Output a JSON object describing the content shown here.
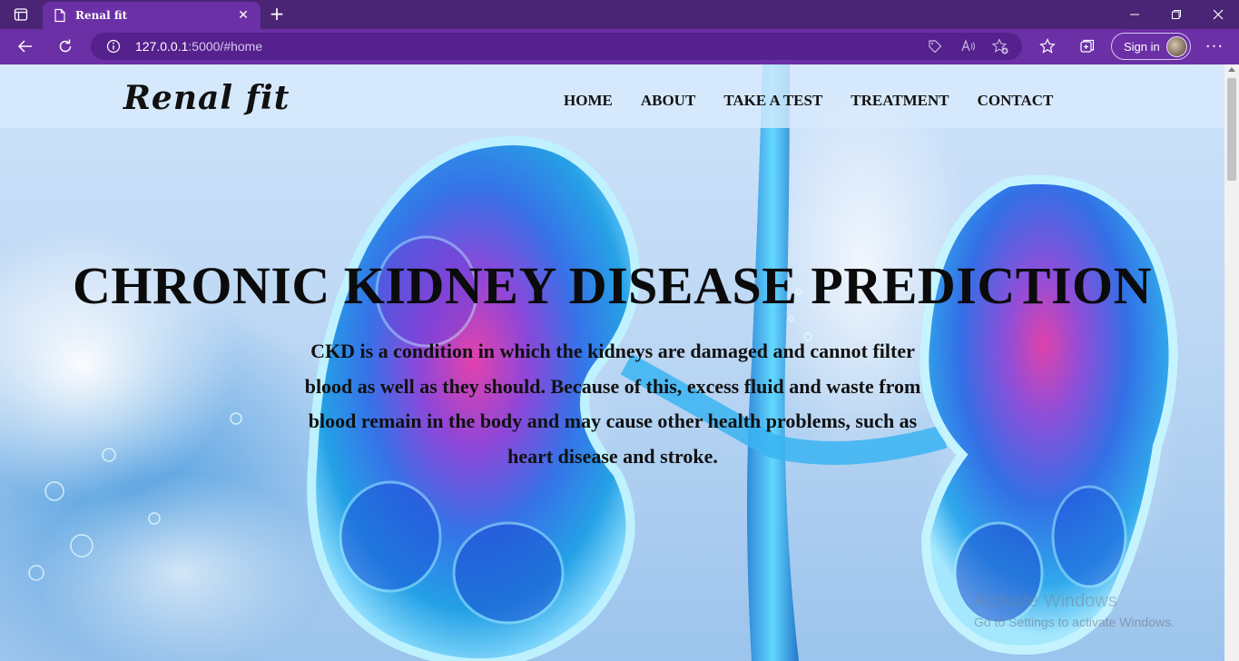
{
  "browser": {
    "tab_title": "Renal fit",
    "new_tab_symbol": "+",
    "close_symbol": "✕",
    "url_host": "127.0.0.1",
    "url_rest": ":5000/#home",
    "sign_in_label": "Sign in",
    "more_symbol": "···"
  },
  "site": {
    "logo": "Renal fit",
    "nav": [
      "HOME",
      "ABOUT",
      "TAKE A TEST",
      "TREATMENT",
      "CONTACT"
    ]
  },
  "hero": {
    "title": "CHRONIC KIDNEY DISEASE PREDICTION",
    "description": "CKD is a condition in which the kidneys are damaged and cannot filter blood as well as they should. Because of this, excess fluid and waste from blood remain in the body and may cause other health problems, such as heart disease and stroke."
  },
  "watermark": {
    "title": "Activate Windows",
    "subtitle": "Go to Settings to activate Windows."
  },
  "colors": {
    "tabbar": "#4a2475",
    "toolbar": "#6b2fa6",
    "addressbar": "#55218c"
  }
}
